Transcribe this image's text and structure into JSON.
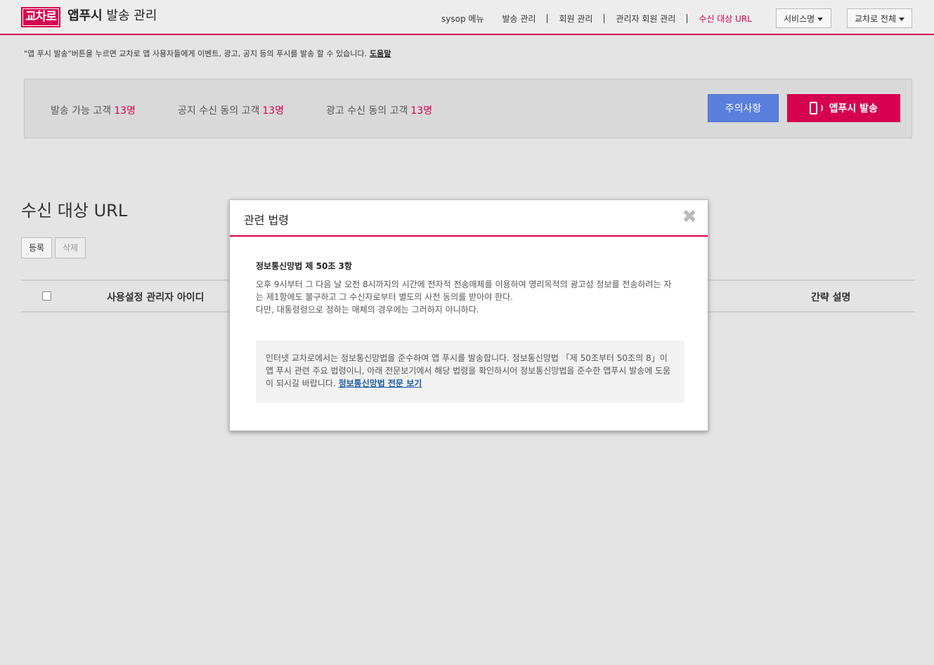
{
  "header": {
    "logo": "교차로",
    "title_bold": "앱푸시",
    "title_rest": "발송 관리",
    "nav": {
      "sysop": "sysop 메뉴",
      "send_manage": "발송 관리",
      "member_manage": "회원 관리",
      "admin_member_manage": "관리자 회원 관리",
      "target_url": "수신 대상 URL"
    },
    "service_dropdown": "서비스명",
    "region_dropdown": "교차로 전체"
  },
  "notice": {
    "text": "\"앱 푸시 발송\"버튼을 누르면 교차로 앱 사용자들에게 이벤트, 광고, 공지 등의 푸시를 발송 할 수 있습니다.",
    "help_link": "도움말"
  },
  "stats": {
    "sendable_label": "발송 가능 고객",
    "sendable_value": "13명",
    "notice_agree_label": "공지 수신 동의 고객",
    "notice_agree_value": "13명",
    "ad_agree_label": "광고 수신 동의 고객",
    "ad_agree_value": "13명",
    "caution_button": "주의사항",
    "push_button": "앱푸시 발송"
  },
  "section": {
    "title": "수신 대상 URL",
    "register_button": "등록",
    "delete_button": "삭제",
    "columns": [
      "사용설정 관리자 아이디",
      "간략 설명"
    ]
  },
  "modal": {
    "title": "관련 법령",
    "law_title": "정보통신망법 제 50조 3항",
    "law_body_1": "오후 9시부터 그 다음 날 오전 8시까지의 시간에 전자적 전송매체를 이용하여 영리목적의 광고성 정보를 전송하려는 자는 제1항에도 불구하고 그 수신자로부터 별도의 사전 동의를 받아야 한다.",
    "law_body_2": "다만, 대통령령으로 정하는 매체의 경우에는 그러하지 아니하다.",
    "box_text": "인터넷 교차로에서는 정보통신망법을 준수하여 앱 푸시를 발송합니다. 정보통신망법 「제 50조부터 50조의 8」이 앱 푸시 관련 주요 법령이니, 아래 전문보기에서 해당 법령을 확인하시어 정보통신망법을 준수한 앱푸시 발송에 도움이 되시길 바랍니다.",
    "box_link": "정보통신망법 전문 보기",
    "close_icon": "close-icon"
  }
}
